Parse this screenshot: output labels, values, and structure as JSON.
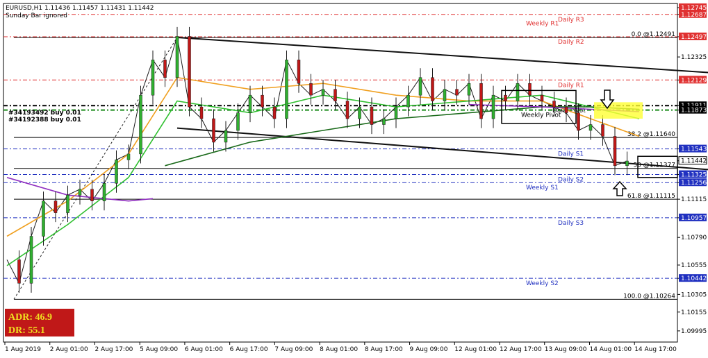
{
  "header": {
    "symbol_line": "EURUSD,H1  1.11436 1.11457 1.11431 1.11442",
    "sub_line": "Sunday Bar ignored"
  },
  "adr_box": {
    "adr": "ADR: 46.9",
    "dr": "DR: 55.1"
  },
  "orders": [
    "#34193492 buy 0.01",
    "#34192388 buy 0.01"
  ],
  "chart_data": {
    "type": "line",
    "title": "",
    "symbol": "EURUSD",
    "timeframe": "H1",
    "ylim": [
      1.099,
      1.1278
    ],
    "y_ticks": [
      "1.12745",
      "1.12687",
      "1.12497",
      "1.12325",
      "1.12129",
      "1.11911",
      "1.11873",
      "1.11543",
      "1.11442",
      "1.11325",
      "1.11256",
      "1.11115",
      "1.10957",
      "1.10790",
      "1.10555",
      "1.10442",
      "1.10305",
      "1.10155",
      "1.09995"
    ],
    "x_ticks": [
      "1 Aug 2019",
      "2 Aug 01:00",
      "2 Aug 17:00",
      "5 Aug 09:00",
      "6 Aug 01:00",
      "6 Aug 17:00",
      "7 Aug 09:00",
      "8 Aug 01:00",
      "8 Aug 17:00",
      "9 Aug 09:00",
      "12 Aug 01:00",
      "12 Aug 17:00",
      "13 Aug 09:00",
      "14 Aug 01:00",
      "14 Aug 17:00"
    ],
    "horizontal_levels": [
      {
        "label": "Daily R3",
        "value": 1.12687,
        "style": "dashdot",
        "color": "#e03030",
        "tag_color": "#e03030"
      },
      {
        "label": "Weekly R1",
        "value": 1.1264,
        "style": "none",
        "color": "#e03030"
      },
      {
        "label": "Daily R2",
        "value": 1.12497,
        "style": "dashdot",
        "color": "#e03030",
        "tag_color": "#e03030"
      },
      {
        "label": "Daily R1",
        "value": 1.12129,
        "style": "dashdot",
        "color": "#e03030",
        "tag_color": "#e03030"
      },
      {
        "label": "Daily Pivot",
        "value": 1.11911,
        "style": "dashdot",
        "color": "#000000",
        "tag_color": "#000000"
      },
      {
        "label": "Weekly Pivot",
        "value": 1.11873,
        "style": "dashdot",
        "color": "#1a8a1a",
        "tag_color": "#000000"
      },
      {
        "label": "Daily S1",
        "value": 1.11543,
        "style": "dashdot",
        "color": "#2030c0",
        "tag_color": "#2030c0"
      },
      {
        "label": "Daily S2",
        "value": 1.11325,
        "style": "dashdot",
        "color": "#2030c0",
        "tag_color": "#2030c0"
      },
      {
        "label": "Weekly S1",
        "value": 1.11256,
        "style": "dashdot",
        "color": "#2030c0",
        "tag_color": "#2030c0"
      },
      {
        "label": "Daily S3",
        "value": 1.10957,
        "style": "dashdot",
        "color": "#2030c0",
        "tag_color": "#2030c0"
      },
      {
        "label": "Weekly S2",
        "value": 1.10442,
        "style": "dashdot",
        "color": "#2030c0",
        "tag_color": "#2030c0"
      }
    ],
    "fib_levels": [
      {
        "label": "0.0 @1.12491",
        "value": 1.12491
      },
      {
        "label": "38.2 @1.11640",
        "value": 1.1164
      },
      {
        "label": "50 @1.11377",
        "value": 1.11377
      },
      {
        "label": "61.8 @1.11115",
        "value": 1.11115
      },
      {
        "label": "100.0 @1.10264",
        "value": 1.10264
      }
    ],
    "current_price": {
      "value": 1.11442,
      "label": "1.11442"
    },
    "extra_tag": {
      "value": 1.12745,
      "label": "1.12745"
    },
    "trendlines": [
      {
        "name": "upper-channel",
        "points": [
          [
            14,
            1.12491
          ],
          [
            61,
            1.1217
          ]
        ]
      },
      {
        "name": "lower-channel",
        "points": [
          [
            14,
            1.1172
          ],
          [
            61,
            1.1134
          ]
        ]
      }
    ],
    "series": [
      {
        "name": "price-path",
        "color": "#1a1a1a",
        "points": [
          [
            0,
            1.106
          ],
          [
            1,
            1.104
          ],
          [
            2,
            1.108
          ],
          [
            3,
            1.111
          ],
          [
            4,
            1.11
          ],
          [
            5,
            1.1115
          ],
          [
            6,
            1.112
          ],
          [
            7,
            1.111
          ],
          [
            8,
            1.1125
          ],
          [
            9,
            1.1145
          ],
          [
            10,
            1.115
          ],
          [
            11,
            1.12
          ],
          [
            12,
            1.123
          ],
          [
            13,
            1.1215
          ],
          [
            14,
            1.125
          ],
          [
            15,
            1.119
          ],
          [
            16,
            1.118
          ],
          [
            17,
            1.116
          ],
          [
            18,
            1.117
          ],
          [
            19,
            1.1185
          ],
          [
            20,
            1.12
          ],
          [
            21,
            1.119
          ],
          [
            22,
            1.118
          ],
          [
            23,
            1.123
          ],
          [
            24,
            1.121
          ],
          [
            25,
            1.12
          ],
          [
            26,
            1.1205
          ],
          [
            27,
            1.1195
          ],
          [
            28,
            1.118
          ],
          [
            29,
            1.119
          ],
          [
            30,
            1.1175
          ],
          [
            31,
            1.118
          ],
          [
            32,
            1.119
          ],
          [
            33,
            1.12
          ],
          [
            34,
            1.1215
          ],
          [
            35,
            1.1195
          ],
          [
            36,
            1.1205
          ],
          [
            37,
            1.12
          ],
          [
            38,
            1.121
          ],
          [
            39,
            1.118
          ],
          [
            40,
            1.12
          ],
          [
            41,
            1.1195
          ],
          [
            42,
            1.121
          ],
          [
            43,
            1.12
          ],
          [
            44,
            1.1195
          ],
          [
            45,
            1.119
          ],
          [
            46,
            1.1185
          ],
          [
            47,
            1.117
          ],
          [
            48,
            1.1175
          ],
          [
            49,
            1.1165
          ],
          [
            50,
            1.114
          ],
          [
            51,
            1.1144
          ]
        ]
      },
      {
        "name": "fast-ma",
        "color": "#f0a020",
        "points": [
          [
            0,
            1.108
          ],
          [
            5,
            1.111
          ],
          [
            10,
            1.115
          ],
          [
            14,
            1.1215
          ],
          [
            20,
            1.1205
          ],
          [
            26,
            1.121
          ],
          [
            32,
            1.12
          ],
          [
            38,
            1.1195
          ],
          [
            44,
            1.1195
          ],
          [
            48,
            1.118
          ],
          [
            52,
            1.1165
          ]
        ]
      },
      {
        "name": "mid-ma",
        "color": "#30c030",
        "points": [
          [
            0,
            1.1055
          ],
          [
            5,
            1.109
          ],
          [
            10,
            1.113
          ],
          [
            14,
            1.1195
          ],
          [
            20,
            1.1185
          ],
          [
            26,
            1.12
          ],
          [
            32,
            1.119
          ],
          [
            38,
            1.1195
          ],
          [
            44,
            1.12
          ],
          [
            48,
            1.119
          ],
          [
            52,
            1.118
          ]
        ]
      },
      {
        "name": "slow-ma",
        "color": "#1a6a1a",
        "points": [
          [
            13,
            1.114
          ],
          [
            20,
            1.116
          ],
          [
            26,
            1.117
          ],
          [
            32,
            1.118
          ],
          [
            38,
            1.1185
          ],
          [
            44,
            1.119
          ],
          [
            48,
            1.119
          ],
          [
            52,
            1.1188
          ]
        ]
      },
      {
        "name": "purple-ma",
        "color": "#9030c0",
        "points": [
          [
            0,
            1.113
          ],
          [
            5,
            1.1115
          ],
          [
            10,
            1.111
          ],
          [
            12,
            1.1112
          ]
        ]
      },
      {
        "name": "purple-ma-2",
        "color": "#9030c0",
        "points": [
          [
            38,
            1.1192
          ],
          [
            44,
            1.119
          ],
          [
            48,
            1.1188
          ],
          [
            52,
            1.1186
          ]
        ]
      }
    ]
  }
}
